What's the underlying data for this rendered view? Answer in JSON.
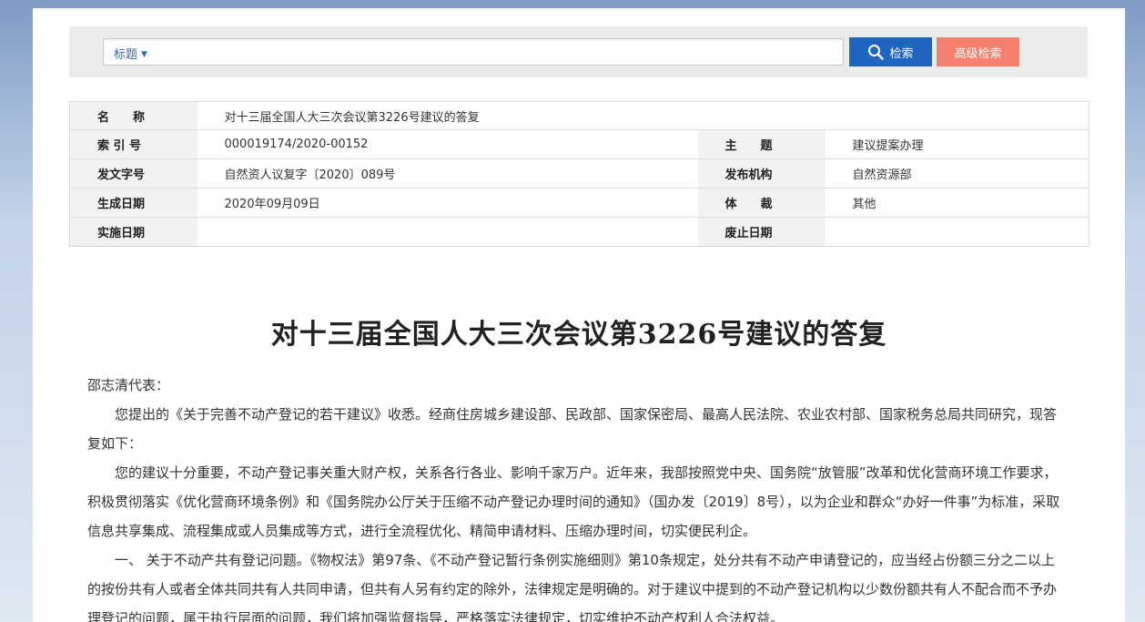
{
  "search": {
    "type_label": "标题",
    "type_caret": "▼",
    "query": "",
    "search_button": "检索",
    "advanced_button": "高级检索"
  },
  "meta": {
    "name_label": "名　　称",
    "name_value": "对十三届全国人大三次会议第3226号建议的答复",
    "index_label": "索 引 号",
    "index_value": "000019174/2020-00152",
    "topic_label": "主　　题",
    "topic_value": "建议提案办理",
    "docno_label": "发文字号",
    "docno_value": "自然资人议复字〔2020〕089号",
    "publisher_label": "发布机构",
    "publisher_value": "自然资源部",
    "date_label": "生成日期",
    "date_value": "2020年09月09日",
    "genre_label": "体　　裁",
    "genre_value": "其他",
    "effective_label": "实施日期",
    "effective_value": "",
    "abolish_label": "废止日期",
    "abolish_value": ""
  },
  "document": {
    "title": "对十三届全国人大三次会议第3226号建议的答复",
    "salutation": "邵志清代表：",
    "paragraphs": [
      "您提出的《关于完善不动产登记的若干建议》收悉。经商住房城乡建设部、民政部、国家保密局、最高人民法院、农业农村部、国家税务总局共同研究，现答复如下：",
      "您的建议十分重要，不动产登记事关重大财产权，关系各行各业、影响千家万户。近年来，我部按照党中央、国务院“放管服”改革和优化营商环境工作要求，积极贯彻落实《优化营商环境条例》和《国务院办公厅关于压缩不动产登记办理时间的通知》（国办发〔2019〕8号），以为企业和群众“办好一件事”为标准，采取信息共享集成、流程集成或人员集成等方式，进行全流程优化、精简申请材料、压缩办理时间，切实便民利企。",
      "一、 关于不动产共有登记问题。《物权法》第97条、《不动产登记暂行条例实施细则》第10条规定，处分共有不动产申请登记的，应当经占份额三分之二以上的按份共有人或者全体共同共有人共同申请，但共有人另有约定的除外，法律规定是明确的。对于建议中提到的不动产登记机构以少数份额共有人不配合而不予办理登记的问题，属于执行层面的问题，我们将加强监督指导，严格落实法律规定，切实维护不动产权利人合法权益。"
    ]
  }
}
